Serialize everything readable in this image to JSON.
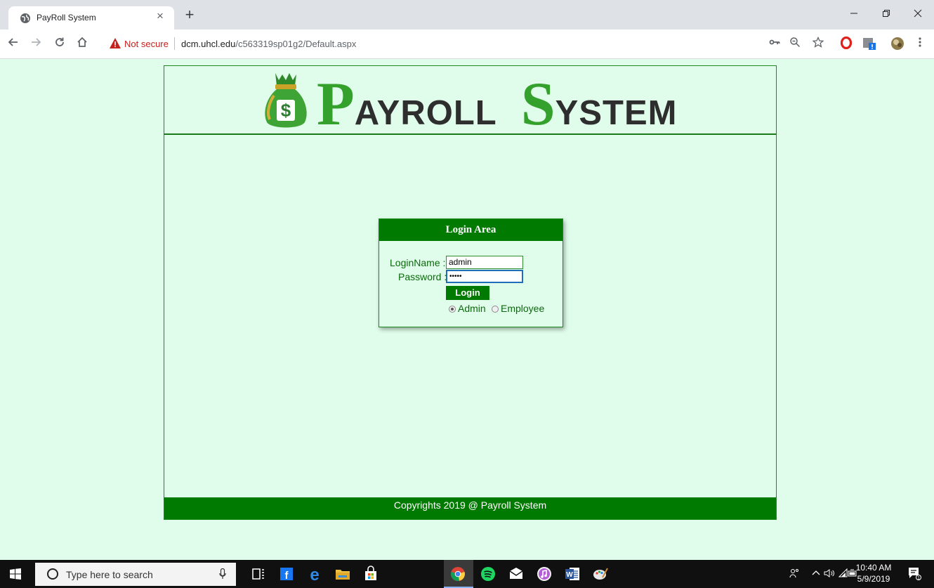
{
  "browser": {
    "tab_title": "PayRoll System",
    "tab_close": "×",
    "new_tab": "+",
    "not_secure": "Not secure",
    "url_host": "dcm.uhcl.edu",
    "url_path": "/c563319sp01g2/Default.aspx"
  },
  "banner": {
    "logo_p": "P",
    "logo_ayroll": "AYROLL",
    "logo_s": "S",
    "logo_ystem": "YSTEM"
  },
  "login": {
    "header": "Login Area",
    "login_name_label": "LoginName :",
    "login_name_value": "admin",
    "password_label": "Password :",
    "password_value": "•••••",
    "button_label": "Login",
    "radio_admin": "Admin",
    "radio_employee": "Employee",
    "selected_role": "Admin"
  },
  "footer": {
    "text": "Copyrights 2019 @ Payroll System"
  },
  "taskbar": {
    "search_placeholder": "Type here to search",
    "time": "10:40 AM",
    "date": "5/9/2019"
  },
  "colors": {
    "accent_green": "#007a00",
    "page_background": "#e0fdeb"
  }
}
